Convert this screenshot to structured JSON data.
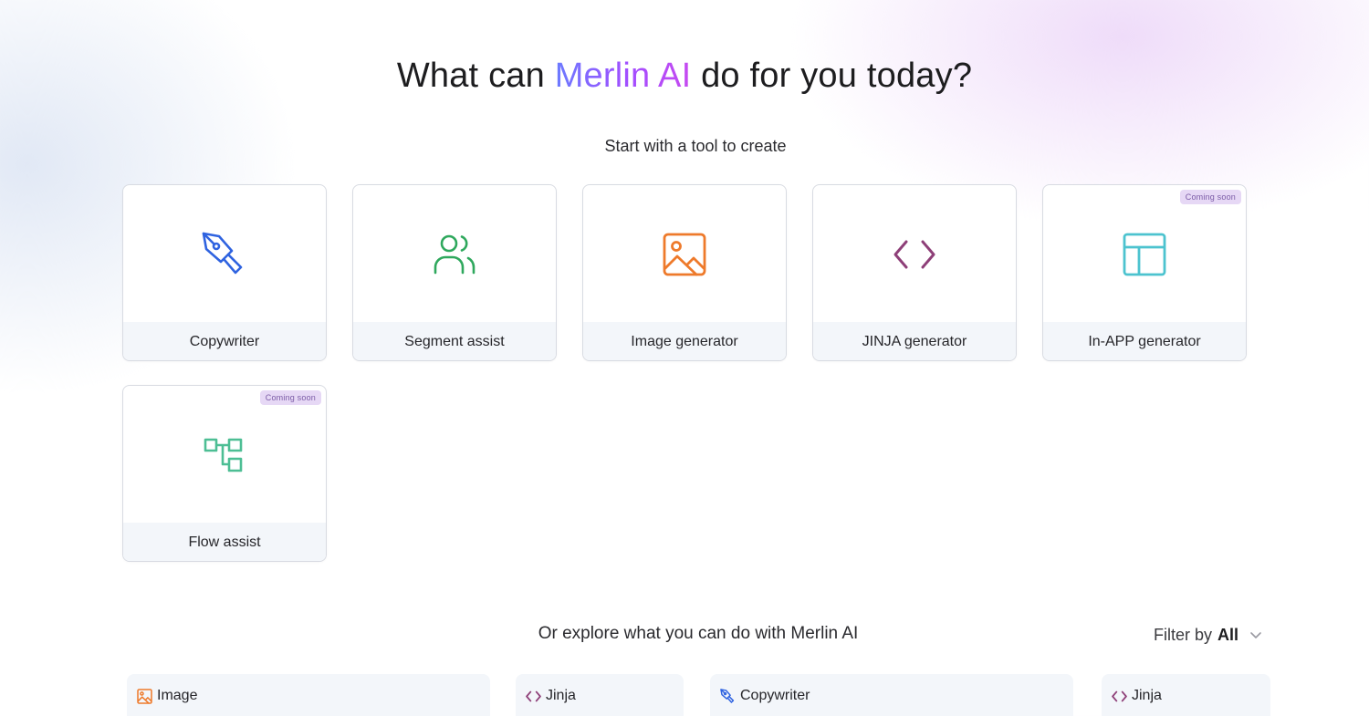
{
  "header": {
    "title_before": "What can ",
    "title_brand": "Merlin AI",
    "title_after": " do for you today?",
    "subtitle": "Start with a tool to create"
  },
  "tools": [
    {
      "label": "Copywriter",
      "icon": "pen-nib-icon",
      "color": "#2f63e0",
      "badge": ""
    },
    {
      "label": "Segment assist",
      "icon": "users-icon",
      "color": "#2fa85d",
      "badge": ""
    },
    {
      "label": "Image generator",
      "icon": "image-icon",
      "color": "#ee7a2b",
      "badge": ""
    },
    {
      "label": "JINJA generator",
      "icon": "code-icon",
      "color": "#8e3f78",
      "badge": ""
    },
    {
      "label": "In-APP generator",
      "icon": "layout-icon",
      "color": "#4cc3cf",
      "badge": "Coming soon"
    },
    {
      "label": "Flow assist",
      "icon": "flow-icon",
      "color": "#4dbe94",
      "badge": "Coming soon"
    }
  ],
  "explore": {
    "heading": "Or explore what you can do with Merlin AI",
    "filter_label": "Filter by",
    "filter_value": "All",
    "tiles": [
      {
        "label": "Image",
        "icon": "image-icon"
      },
      {
        "label": "Jinja",
        "icon": "code-icon"
      },
      {
        "label": "Copywriter",
        "icon": "pen-nib-icon"
      },
      {
        "label": "Jinja",
        "icon": "code-icon"
      }
    ]
  }
}
